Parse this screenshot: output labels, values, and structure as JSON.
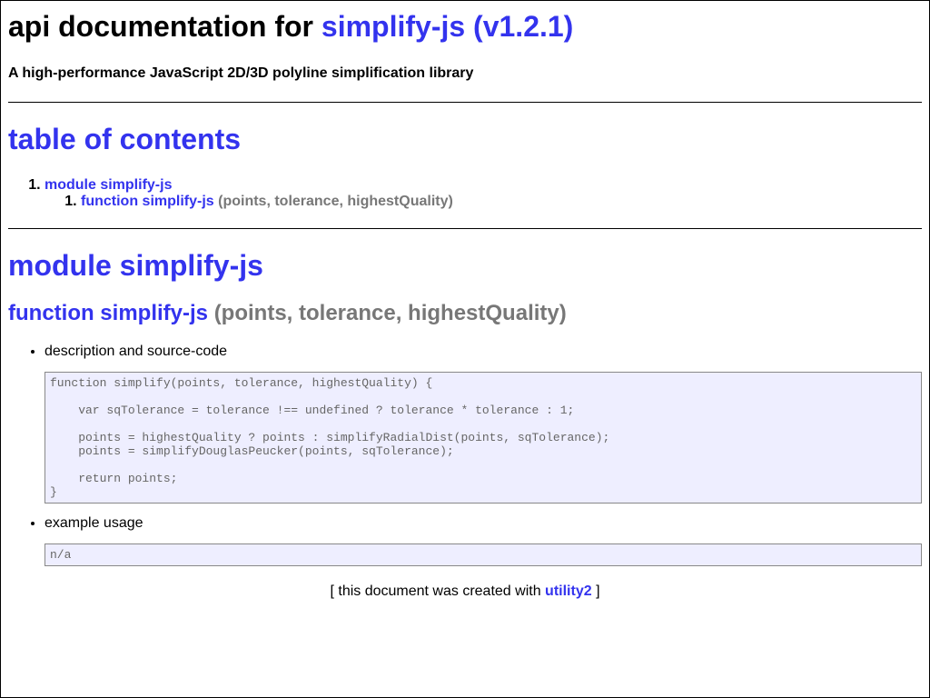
{
  "header": {
    "title_prefix": "api documentation for",
    "title_link": "simplify-js (v1.2.1)",
    "subtitle": "A high-performance JavaScript 2D/3D polyline simplification library"
  },
  "toc": {
    "heading": "table of contents",
    "module_link": "module simplify-js",
    "function_link": "function simplify-js",
    "function_signature": "(points, tolerance, highestQuality)"
  },
  "module": {
    "heading": "module simplify-js",
    "function_name": "function simplify-js",
    "function_signature": "(points, tolerance, highestQuality)",
    "description_label": "description and source-code",
    "source_code": "function simplify(points, tolerance, highestQuality) {\n\n    var sqTolerance = tolerance !== undefined ? tolerance * tolerance : 1;\n\n    points = highestQuality ? points : simplifyRadialDist(points, sqTolerance);\n    points = simplifyDouglasPeucker(points, sqTolerance);\n\n    return points;\n}",
    "example_label": "example usage",
    "example_code": "n/a"
  },
  "footer": {
    "open_bracket": "[ this document was created with",
    "link": "utility2",
    "close_bracket": "]"
  },
  "colors": {
    "link": "#3333ee",
    "signature": "#777777",
    "code_background": "#eeeeff"
  }
}
